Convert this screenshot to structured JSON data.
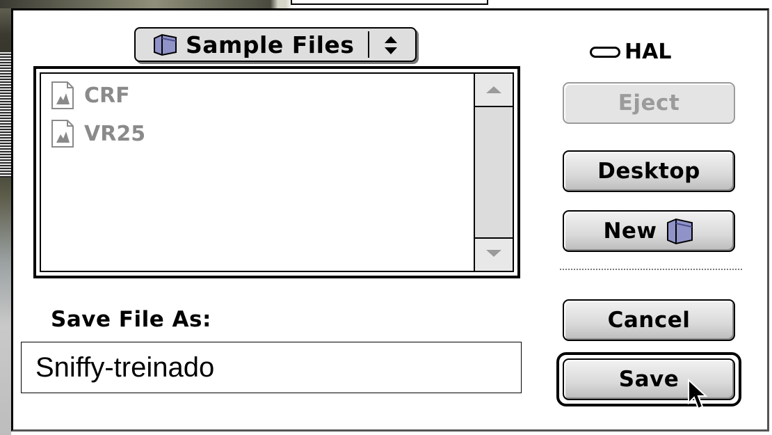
{
  "popup": {
    "label": "Sample Files",
    "icon": "folder-icon"
  },
  "disk": {
    "label": "HAL",
    "icon": "hard-disk-icon"
  },
  "files": [
    {
      "name": "CRF",
      "icon": "document-icon"
    },
    {
      "name": "VR25",
      "icon": "document-icon"
    }
  ],
  "buttons": {
    "eject": "Eject",
    "desktop": "Desktop",
    "new": "New",
    "cancel": "Cancel",
    "save": "Save"
  },
  "save_as": {
    "label": "Save File As:",
    "value": "Sniffy-treinado"
  },
  "colors": {
    "disabled_text": "#9b9b9b",
    "file_text": "#8a8a8a",
    "button_face": "#d9d9d9"
  }
}
